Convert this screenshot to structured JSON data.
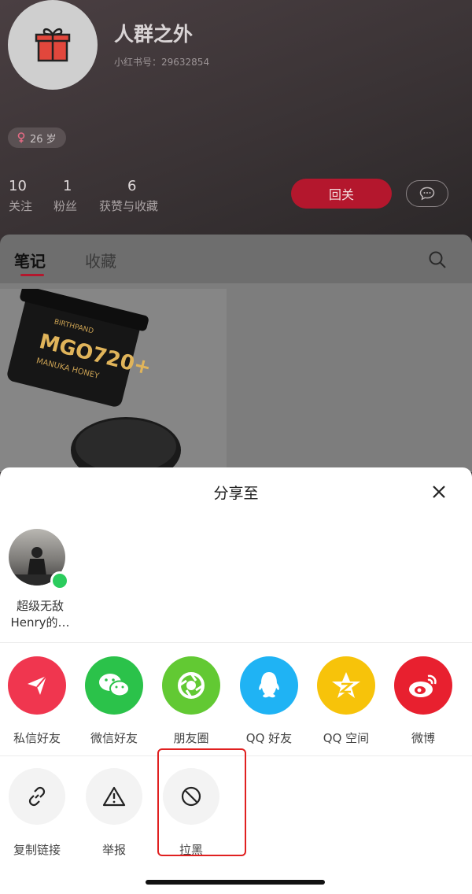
{
  "profile": {
    "name": "人群之外",
    "red_id": "小红书号：29632854",
    "age": "26 岁",
    "stats": [
      {
        "num": "10",
        "label": "关注"
      },
      {
        "num": "1",
        "label": "粉丝"
      },
      {
        "num": "6",
        "label": "获赞与收藏"
      }
    ],
    "follow_label": "回关"
  },
  "tabs": [
    {
      "label": "笔记"
    },
    {
      "label": "收藏"
    }
  ],
  "note_image": {
    "jar_text": "MGO720+",
    "jar_sub": "MANUKA HONEY",
    "brand": "BIRTHPAND"
  },
  "share_sheet": {
    "title": "分享至",
    "contact": {
      "name": "超级无敌Henry的…"
    },
    "share_targets": [
      {
        "label": "私信好友",
        "icon": "send-icon",
        "color": "#f0364f"
      },
      {
        "label": "微信好友",
        "icon": "wechat-icon",
        "color": "#2bc24a"
      },
      {
        "label": "朋友圈",
        "icon": "moments-icon",
        "color": "#62c933"
      },
      {
        "label": "QQ 好友",
        "icon": "qq-icon",
        "color": "#1fb3f4"
      },
      {
        "label": "QQ 空间",
        "icon": "qzone-icon",
        "color": "#f7c30a"
      },
      {
        "label": "微博",
        "icon": "weibo-icon",
        "color": "#e8202f"
      }
    ],
    "tools": [
      {
        "label": "复制链接",
        "icon": "link-icon"
      },
      {
        "label": "举报",
        "icon": "warning-icon"
      },
      {
        "label": "拉黑",
        "icon": "block-icon"
      }
    ]
  }
}
